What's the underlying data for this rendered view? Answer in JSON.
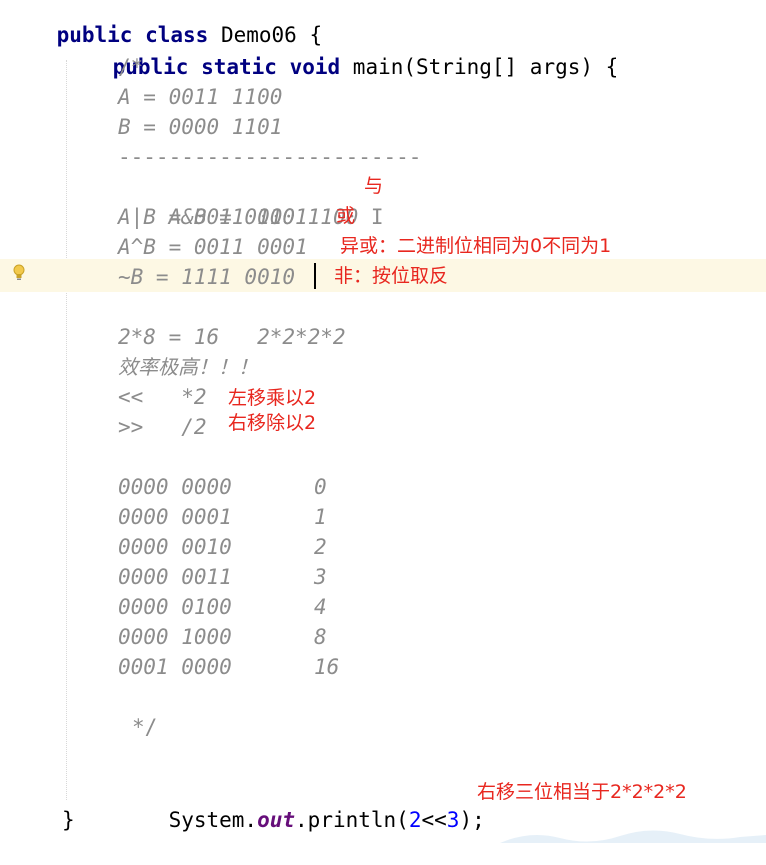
{
  "code": {
    "class_decl": {
      "kw": "public class",
      "rest": " Demo06 {"
    },
    "method_decl": {
      "kw": "public static void",
      "rest": " main(String[] args) {"
    },
    "comment_open": "/*",
    "a_def": "A = 0011 1100",
    "b_def": "B = 0000 1101",
    "separator": "------------------------",
    "and_line": "A&B = 0000 1100",
    "and_cursor": "I",
    "or_line": "A|B = 0011 1101",
    "xor_line": "A^B = 0011 0001",
    "not_line": "~B = 1111 0010",
    "mult_line": "2*8 = 16   2*2*2*2",
    "efficiency_line": "效率极高！！！",
    "shl_line": "<<   *2",
    "shr_line": ">>   /2",
    "table": [
      {
        "bin": "0000 0000",
        "dec": "0"
      },
      {
        "bin": "0000 0001",
        "dec": "1"
      },
      {
        "bin": "0000 0010",
        "dec": "2"
      },
      {
        "bin": "0000 0011",
        "dec": "3"
      },
      {
        "bin": "0000 0100",
        "dec": "4"
      },
      {
        "bin": "0000 1000",
        "dec": "8"
      },
      {
        "bin": "0001 0000",
        "dec": "16"
      }
    ],
    "comment_close": "*/",
    "println": {
      "prefix": "System.",
      "field": "out",
      "mid": ".println(",
      "n1": "2",
      "op": "<<",
      "n2": "3",
      "suffix": ");"
    },
    "close_brace": "}"
  },
  "annotations": {
    "and": "与",
    "or": "或",
    "xor": "异或：二进制位相同为0不同为1",
    "not": "非：按位取反",
    "shl": "左移乘以2",
    "shr": "右移除以2",
    "println": "右移三位相当于2*2*2*2"
  },
  "colors": {
    "keyword": "#000080",
    "comment": "#8c8c8c",
    "number": "#0000ff",
    "field": "#660e7a",
    "annotation": "#e8271f",
    "caret_row": "#fdf8e4"
  },
  "icons": {
    "gutter_hint": "lightbulb-icon"
  }
}
